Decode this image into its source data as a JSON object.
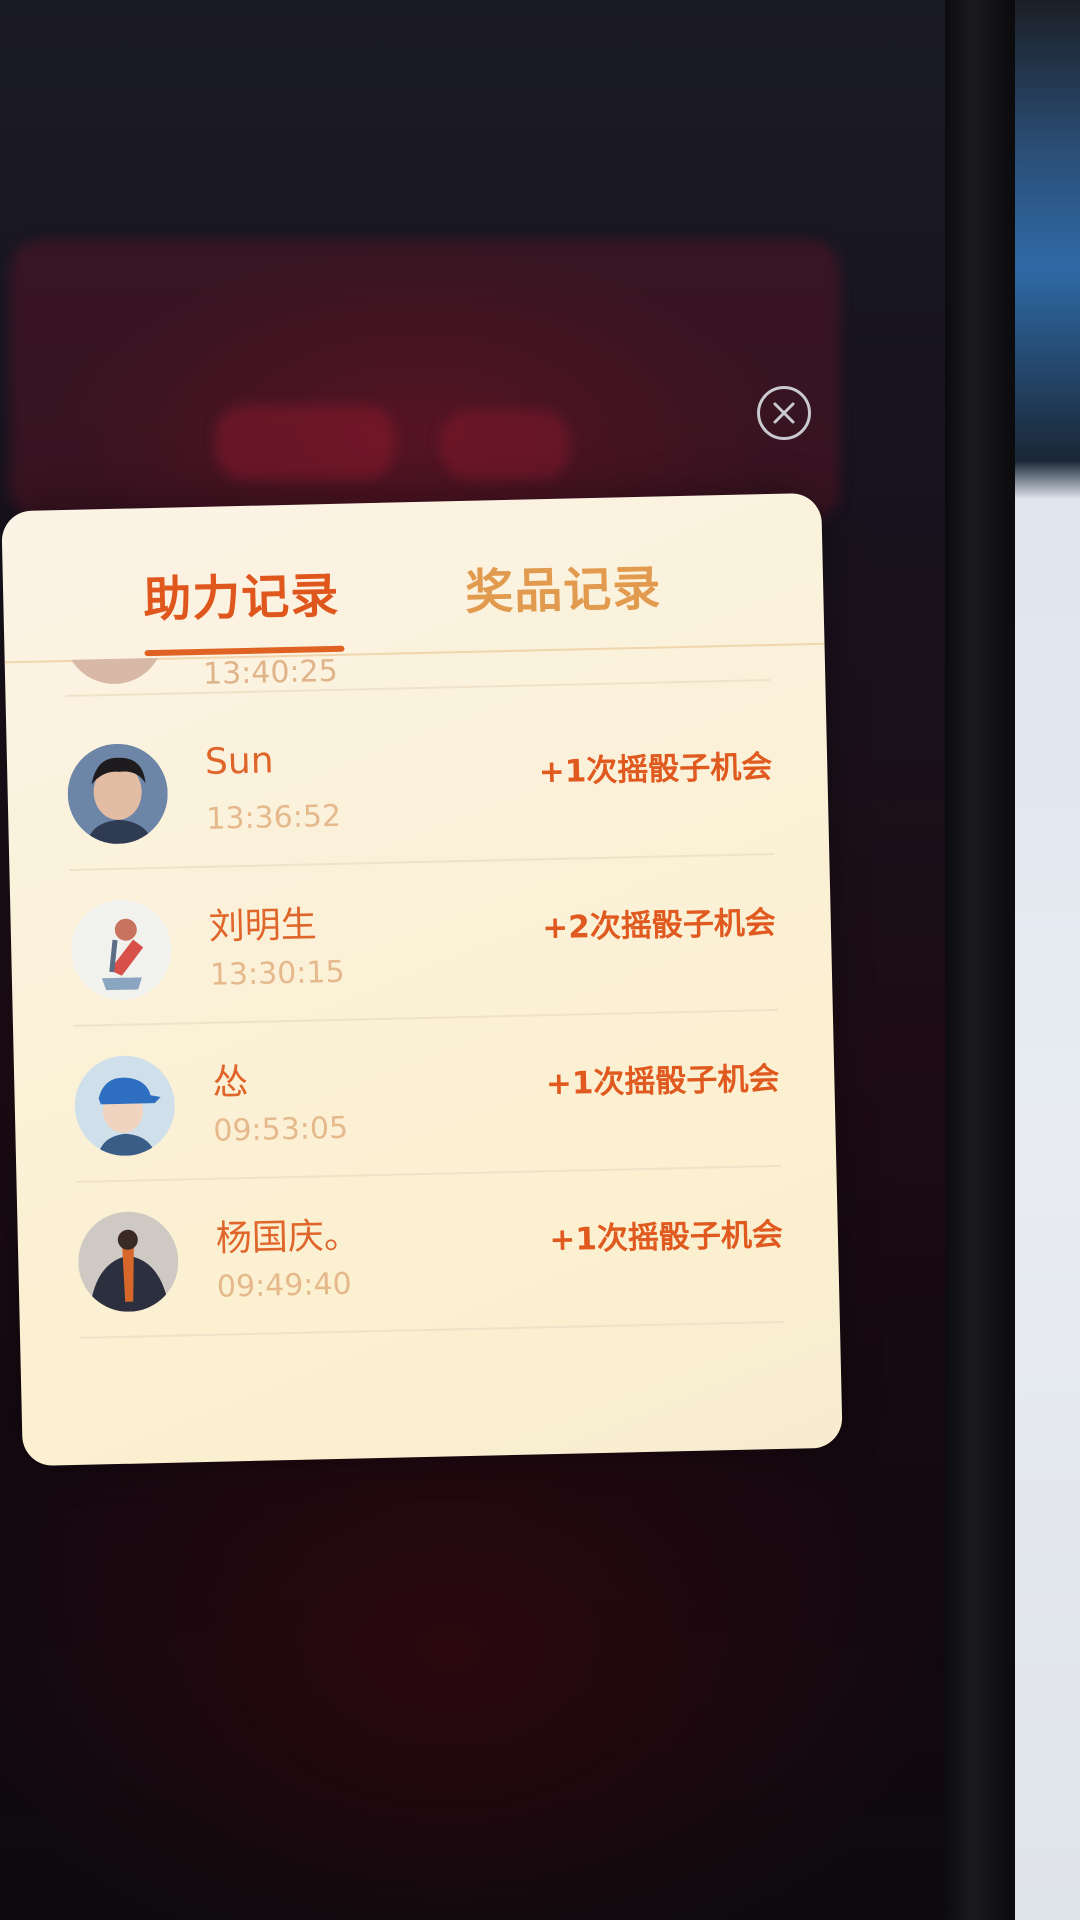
{
  "popup": {
    "close_icon": "close-circle-icon",
    "tabs": [
      {
        "label": "助力记录",
        "active": true
      },
      {
        "label": "奖品记录",
        "active": false
      }
    ],
    "partial_row": {
      "time": "13:40:25"
    },
    "records": [
      {
        "name": "Sun",
        "time": "13:36:52",
        "reward": "+1次摇骰子机会"
      },
      {
        "name": "刘明生",
        "time": "13:30:15",
        "reward": "+2次摇骰子机会"
      },
      {
        "name": "怂",
        "time": "09:53:05",
        "reward": "+1次摇骰子机会"
      },
      {
        "name": "杨国庆。",
        "time": "09:49:40",
        "reward": "+1次摇骰子机会"
      }
    ]
  },
  "colors": {
    "accent": "#e0571e",
    "tab_inactive": "#e29a4e",
    "time_text": "#e5b98c",
    "modal_bg": "#fbf1d9"
  }
}
